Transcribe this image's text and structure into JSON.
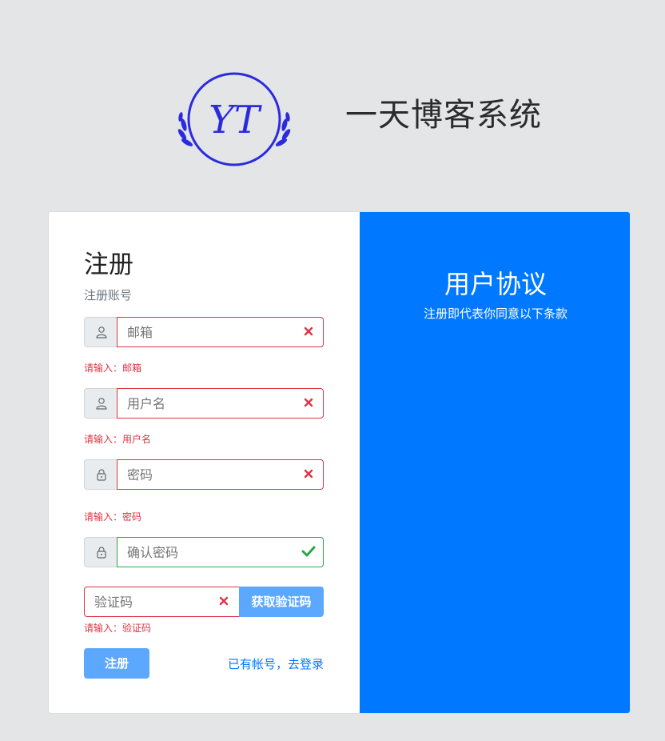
{
  "brand": {
    "logo_text": "YT",
    "title": "一天博客系统",
    "logo_color": "#2b2bde"
  },
  "form": {
    "title": "注册",
    "subtitle": "注册账号",
    "fields": {
      "email": {
        "placeholder": "邮箱",
        "error": "请输入：邮箱",
        "icon": "user-icon",
        "state": "invalid"
      },
      "username": {
        "placeholder": "用户名",
        "error": "请输入：用户名",
        "icon": "user-icon",
        "state": "invalid"
      },
      "password": {
        "placeholder": "密码",
        "error": "请输入：密码",
        "icon": "lock-icon",
        "state": "invalid"
      },
      "confirm_password": {
        "placeholder": "确认密码",
        "icon": "lock-icon",
        "state": "valid"
      },
      "captcha": {
        "placeholder": "验证码",
        "error": "请输入：验证码",
        "state": "invalid",
        "button_label": "获取验证码"
      }
    },
    "submit_label": "注册",
    "login_link": "已有帐号，去登录"
  },
  "agreement": {
    "title": "用户协议",
    "subtitle": "注册即代表你同意以下条款"
  },
  "colors": {
    "primary": "#0078ff",
    "button": "#5ca8ff",
    "error": "#dc3545",
    "success": "#28a745",
    "background": "#e4e5e7"
  }
}
